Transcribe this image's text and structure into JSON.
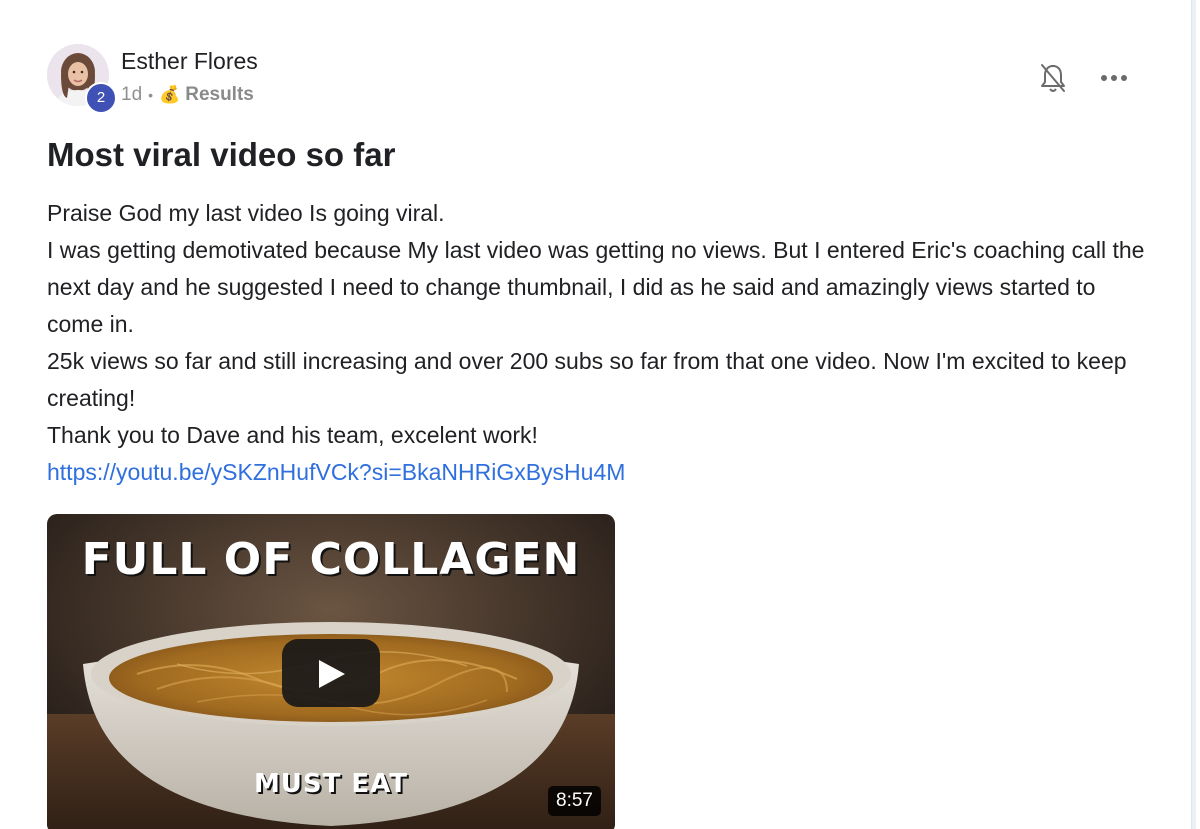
{
  "post": {
    "author": {
      "name": "Esther Flores",
      "level": "2",
      "avatar_icon": "profile-photo"
    },
    "meta": {
      "time": "1d",
      "separator": "•",
      "category_icon": "💰",
      "category": "Results"
    },
    "actions": {
      "bell_icon": "bell-off-icon",
      "more_icon": "more-horizontal-icon"
    },
    "title": "Most viral video so far",
    "body": [
      "Praise God my last video Is going viral.",
      "I was getting demotivated because My last video was getting no views. But I entered Eric's coaching call the next day and he suggested I need to change thumbnail, I did as he said and amazingly views started to come in.",
      "25k views so far and still increasing and over 200 subs so far from that one video. Now I'm excited to keep creating!",
      "Thank you to Dave and his team, excelent work!"
    ],
    "link": "https://youtu.be/ySKZnHufVCk?si=BkaNHRiGxBysHu4M",
    "video": {
      "thumbnail_title": "FULL OF COLLAGEN",
      "thumbnail_subtitle": "MUST EAT",
      "duration": "8:57",
      "play_icon": "play-icon"
    }
  },
  "colors": {
    "link": "#2f6fde",
    "badge": "#3f51b5",
    "meta": "#909090"
  }
}
